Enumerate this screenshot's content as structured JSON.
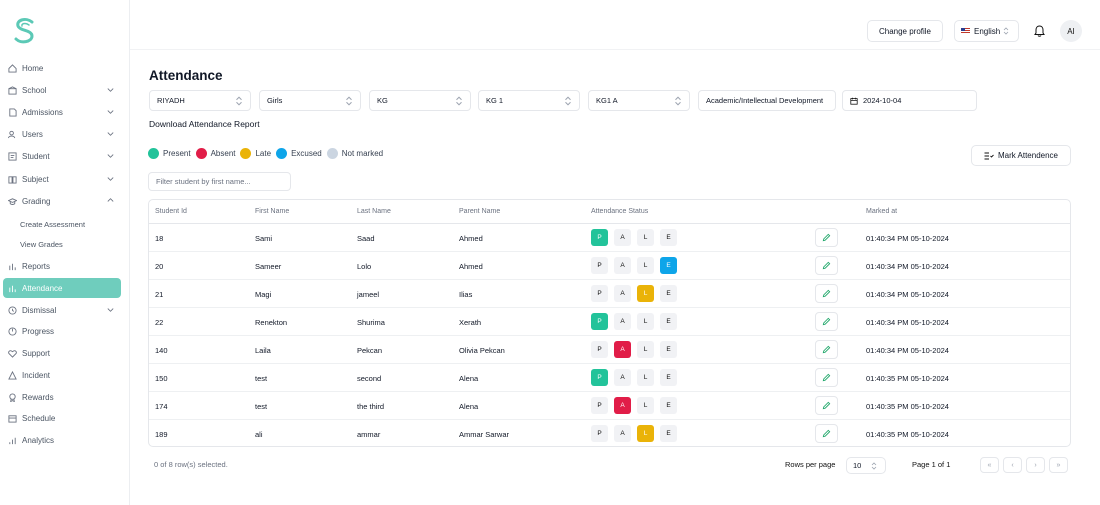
{
  "header": {
    "change_profile": "Change profile",
    "language": "English",
    "avatar": "AI"
  },
  "sidebar": {
    "items": [
      {
        "label": "Home",
        "icon": "home-icon"
      },
      {
        "label": "School",
        "icon": "school-icon"
      },
      {
        "label": "Admissions",
        "icon": "file-icon"
      },
      {
        "label": "Users",
        "icon": "users-icon"
      },
      {
        "label": "Student",
        "icon": "student-icon"
      },
      {
        "label": "Subject",
        "icon": "book-icon"
      },
      {
        "label": "Grading",
        "icon": "graduation-icon"
      },
      {
        "label": "Reports",
        "icon": "chart-icon"
      },
      {
        "label": "Attendance",
        "icon": "chart-icon"
      },
      {
        "label": "Dismissal",
        "icon": "clock-icon"
      },
      {
        "label": "Progress",
        "icon": "progress-icon"
      },
      {
        "label": "Support",
        "icon": "heart-icon"
      },
      {
        "label": "Incident",
        "icon": "alert-icon"
      },
      {
        "label": "Rewards",
        "icon": "award-icon"
      },
      {
        "label": "Schedule",
        "icon": "calendar-icon"
      },
      {
        "label": "Analytics",
        "icon": "analytics-icon"
      }
    ],
    "grading_sub": [
      "Create Assessment",
      "View Grades"
    ]
  },
  "page": {
    "title": "Attendance",
    "filters": [
      "RIYADH",
      "Girls",
      "KG",
      "KG 1",
      "KG1 A",
      "Academic/Intellectual Development"
    ],
    "date": "2024-10-04",
    "download": "Download Attendance Report",
    "mark_button": "Mark Attendence",
    "filter_placeholder": "Filter student by first name..."
  },
  "legend": [
    {
      "label": "Present",
      "color": "#22c39a"
    },
    {
      "label": "Absent",
      "color": "#e11d48"
    },
    {
      "label": "Late",
      "color": "#eab308"
    },
    {
      "label": "Excused",
      "color": "#0ea5e9"
    },
    {
      "label": "Not marked",
      "color": "#cbd5e1"
    }
  ],
  "table": {
    "headers": [
      "Student Id",
      "First Name",
      "Last Name",
      "Parent Name",
      "Attendance Status",
      "Marked at"
    ],
    "status_letters": [
      "P",
      "A",
      "L",
      "E"
    ],
    "rows": [
      {
        "id": "18",
        "first": "Sami",
        "last": "Saad",
        "parent": "Ahmed",
        "status": "P",
        "marked": "01:40:34 PM 05-10-2024"
      },
      {
        "id": "20",
        "first": "Sameer",
        "last": "Lolo",
        "parent": "Ahmed",
        "status": "E",
        "marked": "01:40:34 PM 05-10-2024"
      },
      {
        "id": "21",
        "first": "Magi",
        "last": "jameel",
        "parent": "Ilias",
        "status": "L",
        "marked": "01:40:34 PM 05-10-2024"
      },
      {
        "id": "22",
        "first": "Renekton",
        "last": "Shurima",
        "parent": "Xerath",
        "status": "P",
        "marked": "01:40:34 PM 05-10-2024"
      },
      {
        "id": "140",
        "first": "Laila",
        "last": "Pekcan",
        "parent": "Olivia Pekcan",
        "status": "A",
        "marked": "01:40:34 PM 05-10-2024"
      },
      {
        "id": "150",
        "first": "test",
        "last": "second",
        "parent": "Alena",
        "status": "P",
        "marked": "01:40:35 PM 05-10-2024"
      },
      {
        "id": "174",
        "first": "test",
        "last": "the third",
        "parent": "Alena",
        "status": "A",
        "marked": "01:40:35 PM 05-10-2024"
      },
      {
        "id": "189",
        "first": "ali",
        "last": "ammar",
        "parent": "Ammar Sarwar",
        "status": "L",
        "marked": "01:40:35 PM 05-10-2024"
      }
    ]
  },
  "footer": {
    "selected": "0 of 8 row(s) selected.",
    "rows_per_page_label": "Rows per page",
    "rows_per_page": "10",
    "page": "Page 1 of 1"
  }
}
